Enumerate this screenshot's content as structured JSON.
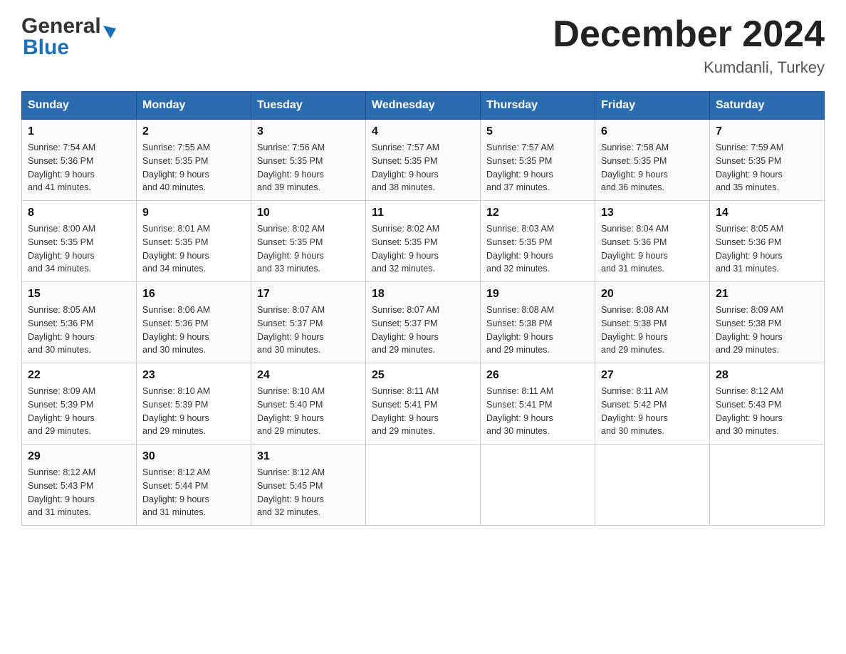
{
  "header": {
    "logo_general": "General",
    "logo_blue": "Blue",
    "month_title": "December 2024",
    "location": "Kumdanli, Turkey"
  },
  "days_of_week": [
    "Sunday",
    "Monday",
    "Tuesday",
    "Wednesday",
    "Thursday",
    "Friday",
    "Saturday"
  ],
  "weeks": [
    [
      {
        "day": "1",
        "sunrise": "7:54 AM",
        "sunset": "5:36 PM",
        "daylight": "9 hours and 41 minutes."
      },
      {
        "day": "2",
        "sunrise": "7:55 AM",
        "sunset": "5:35 PM",
        "daylight": "9 hours and 40 minutes."
      },
      {
        "day": "3",
        "sunrise": "7:56 AM",
        "sunset": "5:35 PM",
        "daylight": "9 hours and 39 minutes."
      },
      {
        "day": "4",
        "sunrise": "7:57 AM",
        "sunset": "5:35 PM",
        "daylight": "9 hours and 38 minutes."
      },
      {
        "day": "5",
        "sunrise": "7:57 AM",
        "sunset": "5:35 PM",
        "daylight": "9 hours and 37 minutes."
      },
      {
        "day": "6",
        "sunrise": "7:58 AM",
        "sunset": "5:35 PM",
        "daylight": "9 hours and 36 minutes."
      },
      {
        "day": "7",
        "sunrise": "7:59 AM",
        "sunset": "5:35 PM",
        "daylight": "9 hours and 35 minutes."
      }
    ],
    [
      {
        "day": "8",
        "sunrise": "8:00 AM",
        "sunset": "5:35 PM",
        "daylight": "9 hours and 34 minutes."
      },
      {
        "day": "9",
        "sunrise": "8:01 AM",
        "sunset": "5:35 PM",
        "daylight": "9 hours and 34 minutes."
      },
      {
        "day": "10",
        "sunrise": "8:02 AM",
        "sunset": "5:35 PM",
        "daylight": "9 hours and 33 minutes."
      },
      {
        "day": "11",
        "sunrise": "8:02 AM",
        "sunset": "5:35 PM",
        "daylight": "9 hours and 32 minutes."
      },
      {
        "day": "12",
        "sunrise": "8:03 AM",
        "sunset": "5:35 PM",
        "daylight": "9 hours and 32 minutes."
      },
      {
        "day": "13",
        "sunrise": "8:04 AM",
        "sunset": "5:36 PM",
        "daylight": "9 hours and 31 minutes."
      },
      {
        "day": "14",
        "sunrise": "8:05 AM",
        "sunset": "5:36 PM",
        "daylight": "9 hours and 31 minutes."
      }
    ],
    [
      {
        "day": "15",
        "sunrise": "8:05 AM",
        "sunset": "5:36 PM",
        "daylight": "9 hours and 30 minutes."
      },
      {
        "day": "16",
        "sunrise": "8:06 AM",
        "sunset": "5:36 PM",
        "daylight": "9 hours and 30 minutes."
      },
      {
        "day": "17",
        "sunrise": "8:07 AM",
        "sunset": "5:37 PM",
        "daylight": "9 hours and 30 minutes."
      },
      {
        "day": "18",
        "sunrise": "8:07 AM",
        "sunset": "5:37 PM",
        "daylight": "9 hours and 29 minutes."
      },
      {
        "day": "19",
        "sunrise": "8:08 AM",
        "sunset": "5:38 PM",
        "daylight": "9 hours and 29 minutes."
      },
      {
        "day": "20",
        "sunrise": "8:08 AM",
        "sunset": "5:38 PM",
        "daylight": "9 hours and 29 minutes."
      },
      {
        "day": "21",
        "sunrise": "8:09 AM",
        "sunset": "5:38 PM",
        "daylight": "9 hours and 29 minutes."
      }
    ],
    [
      {
        "day": "22",
        "sunrise": "8:09 AM",
        "sunset": "5:39 PM",
        "daylight": "9 hours and 29 minutes."
      },
      {
        "day": "23",
        "sunrise": "8:10 AM",
        "sunset": "5:39 PM",
        "daylight": "9 hours and 29 minutes."
      },
      {
        "day": "24",
        "sunrise": "8:10 AM",
        "sunset": "5:40 PM",
        "daylight": "9 hours and 29 minutes."
      },
      {
        "day": "25",
        "sunrise": "8:11 AM",
        "sunset": "5:41 PM",
        "daylight": "9 hours and 29 minutes."
      },
      {
        "day": "26",
        "sunrise": "8:11 AM",
        "sunset": "5:41 PM",
        "daylight": "9 hours and 30 minutes."
      },
      {
        "day": "27",
        "sunrise": "8:11 AM",
        "sunset": "5:42 PM",
        "daylight": "9 hours and 30 minutes."
      },
      {
        "day": "28",
        "sunrise": "8:12 AM",
        "sunset": "5:43 PM",
        "daylight": "9 hours and 30 minutes."
      }
    ],
    [
      {
        "day": "29",
        "sunrise": "8:12 AM",
        "sunset": "5:43 PM",
        "daylight": "9 hours and 31 minutes."
      },
      {
        "day": "30",
        "sunrise": "8:12 AM",
        "sunset": "5:44 PM",
        "daylight": "9 hours and 31 minutes."
      },
      {
        "day": "31",
        "sunrise": "8:12 AM",
        "sunset": "5:45 PM",
        "daylight": "9 hours and 32 minutes."
      },
      null,
      null,
      null,
      null
    ]
  ],
  "labels": {
    "sunrise": "Sunrise:",
    "sunset": "Sunset:",
    "daylight": "Daylight:"
  }
}
